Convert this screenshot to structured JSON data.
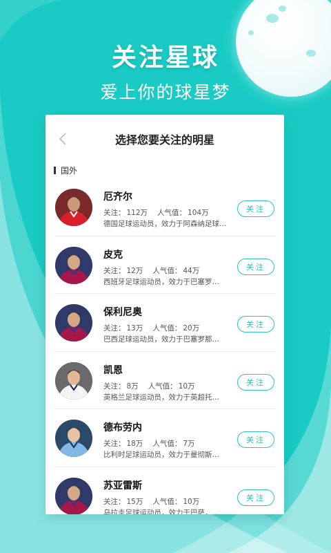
{
  "hero": {
    "title": "关注星球",
    "subtitle": "爱上你的球星梦"
  },
  "dialog": {
    "title": "选择您要关注的明星",
    "back_icon": "chevron-left-icon",
    "section_label": "国外"
  },
  "stat_labels": {
    "followers": "关注：",
    "popularity": "人气值："
  },
  "colors": {
    "background": "#19cbc4",
    "accent": "#29c4be"
  },
  "players": [
    {
      "name": "厄齐尔",
      "followers": "112万",
      "popularity": "104万",
      "desc": "德国足球运动员，效力于阿森纳足球…",
      "button": "关注",
      "kit": "arsenal"
    },
    {
      "name": "皮克",
      "followers": "12万",
      "popularity": "44万",
      "desc": "西班牙足球运动员，效力于巴塞罗…",
      "button": "关注",
      "kit": "barca"
    },
    {
      "name": "保利尼奥",
      "followers": "13万",
      "popularity": "20万",
      "desc": "巴西足球运动员，效力于巴塞罗那…",
      "button": "关注",
      "kit": "barca"
    },
    {
      "name": "凯恩",
      "followers": "8万",
      "popularity": "10万",
      "desc": "英格兰足球运动员，效力于英超托…",
      "button": "关注",
      "kit": "spurs"
    },
    {
      "name": "德布劳内",
      "followers": "18万",
      "popularity": "7万",
      "desc": "比利时足球运动员，效力于曼彻斯…",
      "button": "关注",
      "kit": "mancity"
    },
    {
      "name": "苏亚雷斯",
      "followers": "15万",
      "popularity": "10万",
      "desc": "乌拉圭足球运动员，效力于巴萨，…",
      "button": "关注",
      "kit": "barca"
    }
  ]
}
